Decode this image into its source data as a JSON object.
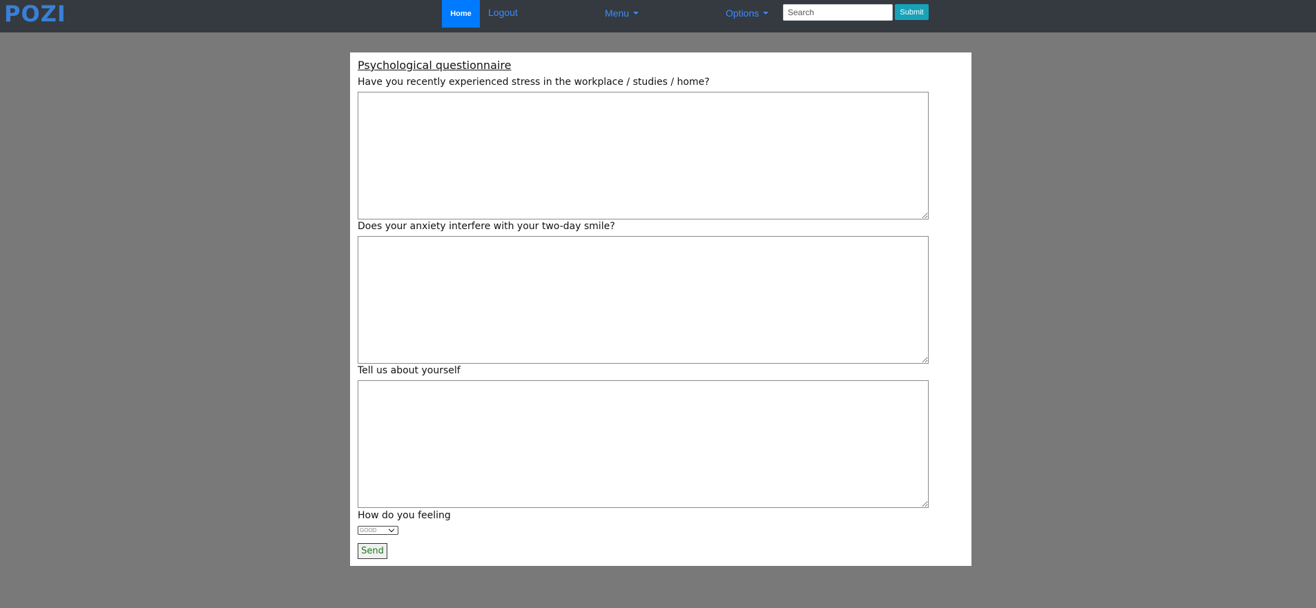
{
  "navbar": {
    "brand": "POZI",
    "home_label": "Home",
    "logout_label": "Logout",
    "menu_label": "Menu",
    "options_label": "Options",
    "search_placeholder": "Search",
    "search_value": "",
    "submit_label": "Submit",
    "colors": {
      "background": "#343a40",
      "home_active": "#007bff",
      "submit": "#17a2b8",
      "link": "#3d8bff"
    }
  },
  "form": {
    "title": "Psychological questionnaire",
    "questions": [
      {
        "label": "Have you recently experienced stress in the workplace / studies / home?",
        "value": ""
      },
      {
        "label": "Does your anxiety interfere with your two-day smile?",
        "value": ""
      },
      {
        "label": "Tell us about yourself",
        "value": ""
      }
    ],
    "feeling_label": "How do you feeling",
    "feeling_selected": "GOOD",
    "send_label": "Send"
  },
  "icons": {
    "menu_caret": "caret-down-icon",
    "options_caret": "caret-down-icon",
    "select_chevron": "chevron-down-icon"
  }
}
